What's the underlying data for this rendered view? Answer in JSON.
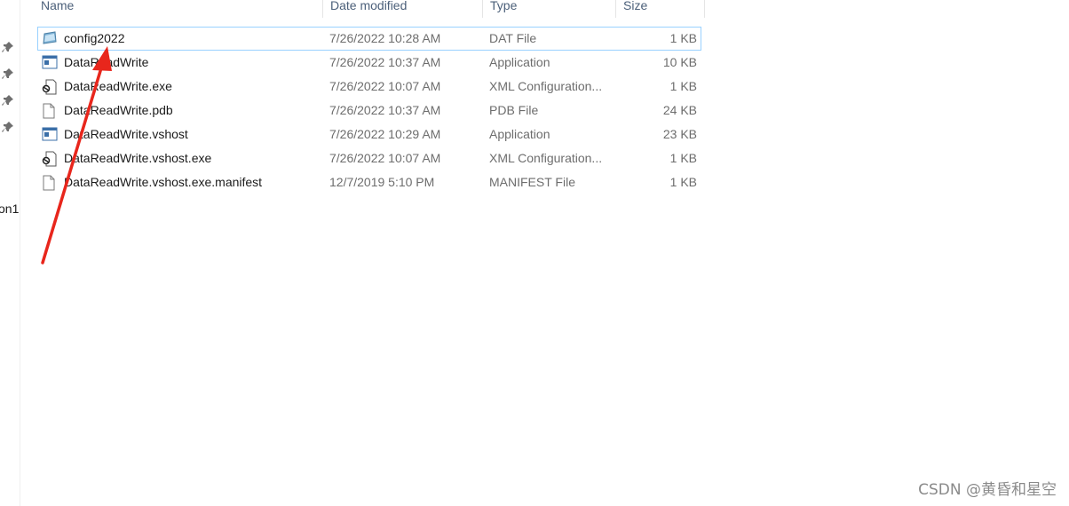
{
  "columns": {
    "name": "Name",
    "date_modified": "Date modified",
    "type": "Type",
    "size": "Size"
  },
  "nav": {
    "partial_label": "on1"
  },
  "files": [
    {
      "name": "config2022",
      "date": "7/26/2022 10:28 AM",
      "type": "DAT File",
      "size": "1 KB",
      "icon": "dat-file-icon"
    },
    {
      "name": "DataReadWrite",
      "date": "7/26/2022 10:37 AM",
      "type": "Application",
      "size": "10 KB",
      "icon": "application-icon"
    },
    {
      "name": "DataReadWrite.exe",
      "date": "7/26/2022 10:07 AM",
      "type": "XML Configuration...",
      "size": "1 KB",
      "icon": "xml-config-icon"
    },
    {
      "name": "DataReadWrite.pdb",
      "date": "7/26/2022 10:37 AM",
      "type": "PDB File",
      "size": "24 KB",
      "icon": "blank-file-icon"
    },
    {
      "name": "DataReadWrite.vshost",
      "date": "7/26/2022 10:29 AM",
      "type": "Application",
      "size": "23 KB",
      "icon": "application-icon"
    },
    {
      "name": "DataReadWrite.vshost.exe",
      "date": "7/26/2022 10:07 AM",
      "type": "XML Configuration...",
      "size": "1 KB",
      "icon": "xml-config-icon"
    },
    {
      "name": "DataReadWrite.vshost.exe.manifest",
      "date": "12/7/2019 5:10 PM",
      "type": "MANIFEST File",
      "size": "1 KB",
      "icon": "blank-file-icon"
    }
  ],
  "watermark": "CSDN @黄昏和星空",
  "colors": {
    "annotation_arrow": "#e8261c",
    "selection_border": "#99d1ff",
    "header_text": "#4c607a"
  }
}
